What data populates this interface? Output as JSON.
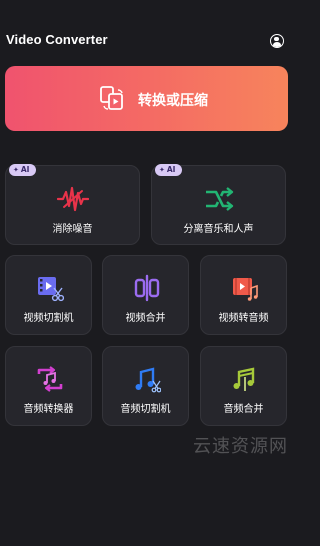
{
  "header": {
    "title": "Video Converter",
    "profile_icon": "user-profile-icon"
  },
  "convert_button": {
    "label": "转换或压缩",
    "icon": "convert-swap-icon",
    "gradient": [
      "#f0536e",
      "#f7845c"
    ]
  },
  "ai_badge": "AI",
  "ai_tools": [
    {
      "label": "消除噪音",
      "icon": "noise-waveform-icon",
      "color": "#e8334a",
      "badge": "AI"
    },
    {
      "label": "分离音乐和人声",
      "icon": "split-arrows-icon",
      "color": "#22b573",
      "badge": "AI"
    }
  ],
  "tools_row1": [
    {
      "label": "视频切割机",
      "icon": "video-cut-icon",
      "color": "#6a6cf0"
    },
    {
      "label": "视频合并",
      "icon": "video-merge-icon",
      "color": "#9b6cf0"
    },
    {
      "label": "视频转音频",
      "icon": "video-to-audio-icon",
      "color": "#f05a4a"
    }
  ],
  "tools_row2": [
    {
      "label": "音频转换器",
      "icon": "audio-convert-icon",
      "color": "#d23fcf"
    },
    {
      "label": "音频切割机",
      "icon": "audio-cut-icon",
      "color": "#2f7cf6"
    },
    {
      "label": "音频合并",
      "icon": "audio-merge-icon",
      "color": "#a6c93a"
    }
  ],
  "watermark": "云速资源网"
}
